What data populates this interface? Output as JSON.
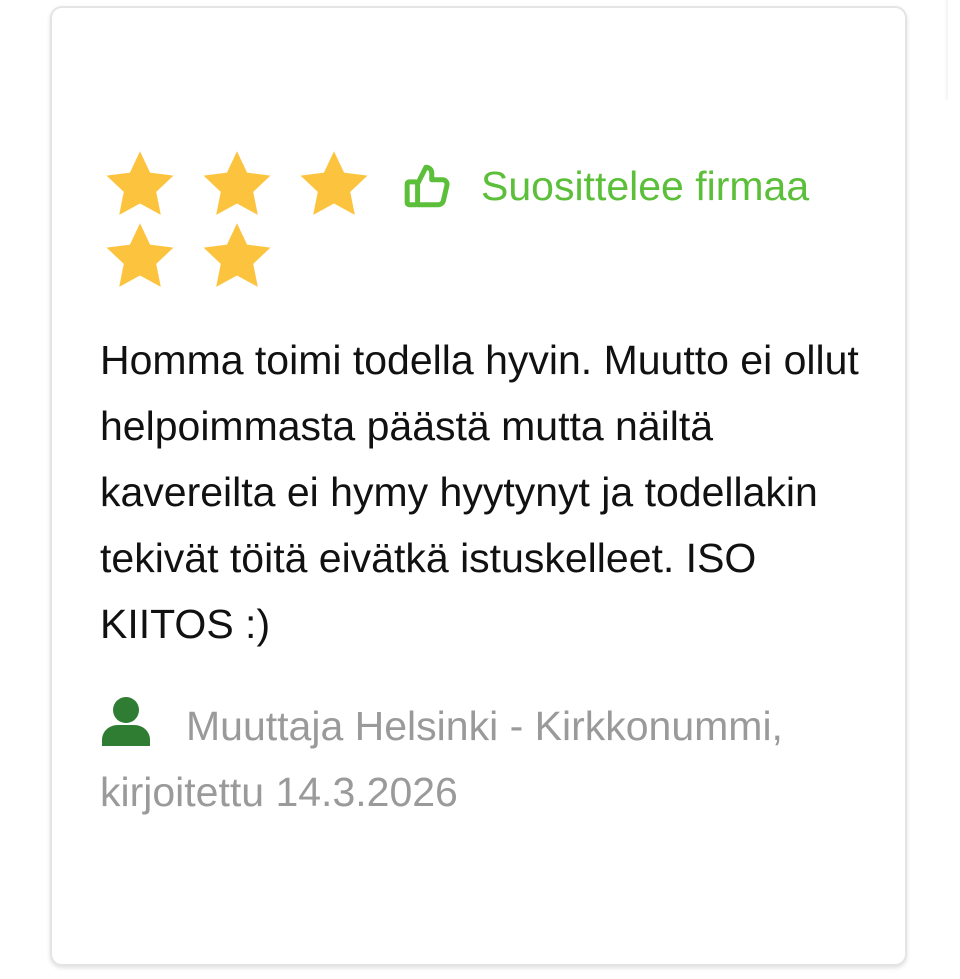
{
  "review": {
    "rating": 5,
    "rating_max": 5,
    "recommend_label": "Suosittelee firmaa",
    "text": "Homma toimi todella hyvin. Muutto ei ollut helpoimmasta päästä mutta näiltä kavereilta ei hymy hyytynyt ja todellakin tekivät töitä eivätkä istuskelleet. ISO KIITOS :)",
    "author_line": "Muuttaja Helsinki - Kirkkonummi, kirjoitettu 14.3.2026"
  },
  "icons": {
    "star": "star-icon",
    "recommend": "thumbs-up-icon",
    "author": "user-icon"
  },
  "colors": {
    "star": "#fcc43e",
    "recommend": "#5cbf3a",
    "author_icon": "#2f7d32",
    "text": "#111111",
    "meta_text": "#9a9a9a"
  }
}
